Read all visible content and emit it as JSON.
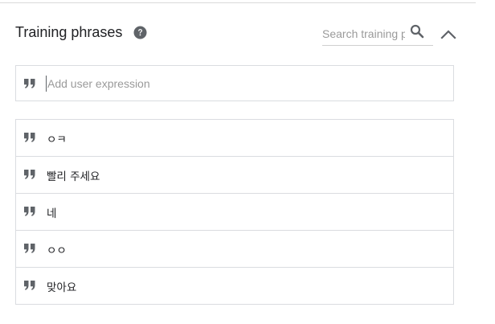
{
  "section": {
    "title": "Training phrases",
    "search": {
      "placeholder": "Search training phrases"
    }
  },
  "add_expression": {
    "placeholder": "Add user expression"
  },
  "phrases": [
    {
      "text": "ㅇㅋ"
    },
    {
      "text": "빨리 주세요"
    },
    {
      "text": "네"
    },
    {
      "text": "ㅇㅇ"
    },
    {
      "text": "맞아요"
    }
  ],
  "icons": {
    "help": "help-circle-icon",
    "search": "search-icon",
    "collapse": "chevron-up-icon",
    "quote": "quote-icon"
  },
  "colors": {
    "icon": "#5f6368",
    "border": "#dadce0",
    "placeholder": "#9a9a9a"
  }
}
